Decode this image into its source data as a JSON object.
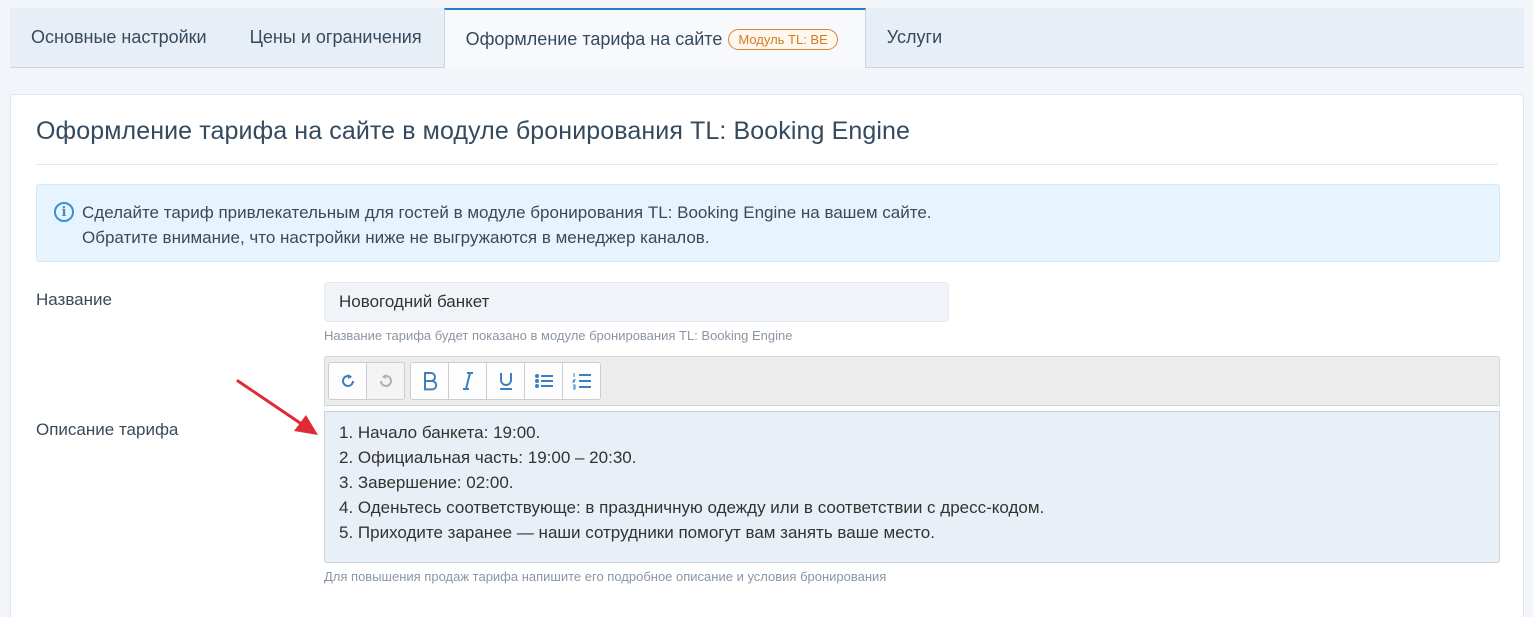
{
  "tabs": [
    {
      "label": "Основные настройки"
    },
    {
      "label": "Цены и ограничения"
    },
    {
      "label": "Оформление тарифа на сайте",
      "badge": "Модуль TL: BE",
      "active": true
    },
    {
      "label": "Услуги"
    }
  ],
  "section": {
    "title": "Оформление тарифа на сайте в модуле бронирования TL: Booking Engine"
  },
  "info": {
    "line1": "Сделайте тариф привлекательным для гостей в модуле бронирования TL: Booking Engine на вашем сайте.",
    "line2": "Обратите внимание, что настройки ниже не выгружаются в менеджер каналов.",
    "icon": "info-icon"
  },
  "name_field": {
    "label": "Название",
    "value": "Новогодний банкет",
    "help": "Название тарифа будет показано в модуле бронирования TL: Booking Engine"
  },
  "description_field": {
    "label": "Описание тарифа",
    "lines": [
      "1. Начало банкета: 19:00.",
      "2. Официальная часть: 19:00 – 20:30.",
      "3. Завершение: 02:00.",
      "4. Оденьтесь соответствующе: в праздничную одежду или в соответствии с дресс-кодом.",
      "5. Приходите заранее — наши сотрудники помогут вам занять ваше место."
    ],
    "help": "Для повышения продаж тарифа напишите его подробное описание и условия бронирования"
  },
  "toolbar": {
    "icons": [
      "redo-icon",
      "undo-icon",
      "bold-icon",
      "italic-icon",
      "underline-icon",
      "bullet-list-icon",
      "numbered-list-icon"
    ]
  },
  "colors": {
    "accent": "#2d7cc2",
    "badge": "#d27c21",
    "info_bg": "#e7f4fd",
    "arrow": "#e02b35"
  }
}
